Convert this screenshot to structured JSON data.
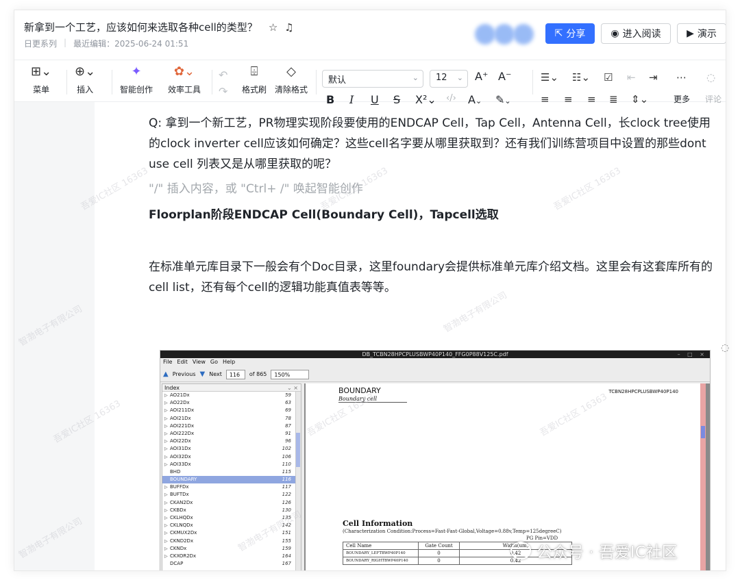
{
  "header": {
    "title": "新拿到一个工艺，应该如何来选取各种cell的类型？",
    "series": "日更系列",
    "last_edit": "最近编辑：2025-06-24 01:51",
    "share_label": "分享",
    "read_label": "进入阅读",
    "present_label": "演示"
  },
  "toolbar": {
    "menu_label": "菜单",
    "insert_label": "插入",
    "ai_label": "智能创作",
    "efficiency_label": "效率工具",
    "format_painter_label": "格式刷",
    "clear_format_label": "清除格式",
    "font_family": "默认",
    "font_size": "12",
    "more_label": "更多",
    "comment_label": "评论"
  },
  "content": {
    "question": "Q: 拿到一个新工艺，PR物理实现阶段要使用的ENDCAP Cell，Tap Cell，Antenna Cell，长clock tree使用的clock inverter cell应该如何确定？这些cell名字要从哪里获取到？还有我们训练营项目中设置的那些dont use cell 列表又是从哪里获取的呢？",
    "placeholder": "\"/\" 插入内容，或 \"Ctrl+ /\" 唤起智能创作",
    "heading": "Floorplan阶段ENDCAP Cell(Boundary Cell)，Tapcell选取",
    "paragraph": "在标准单元库目录下一般会有个Doc目录，这里foundary会提供标准单元库介绍文档。这里会有这套库所有的cell list，还有每个cell的逻辑功能真值表等等。"
  },
  "pdf_viewer": {
    "window_title": "DB_TCBN28HPCPLUSBWP40P140_FFG0P88V125C.pdf",
    "menu": [
      "File",
      "Edit",
      "View",
      "Go",
      "Help"
    ],
    "previous_label": "Previous",
    "next_label": "Next",
    "page_number": "116",
    "page_total": "of 865",
    "zoom": "150%",
    "index_header": "Index",
    "index_items": [
      {
        "name": "AO21Dx",
        "page": "59"
      },
      {
        "name": "AO22Dx",
        "page": "63"
      },
      {
        "name": "AOI211Dx",
        "page": "69"
      },
      {
        "name": "AOI21Dx",
        "page": "78"
      },
      {
        "name": "AOI221Dx",
        "page": "87"
      },
      {
        "name": "AOI222Dx",
        "page": "91"
      },
      {
        "name": "AOI22Dx",
        "page": "96"
      },
      {
        "name": "AOI31Dx",
        "page": "102"
      },
      {
        "name": "AOI32Dx",
        "page": "106"
      },
      {
        "name": "AOI33Dx",
        "page": "110"
      },
      {
        "name": "BHD",
        "page": "115"
      },
      {
        "name": "BOUNDARY",
        "page": "116"
      },
      {
        "name": "BUFFDx",
        "page": "117"
      },
      {
        "name": "BUFTDx",
        "page": "122"
      },
      {
        "name": "CKAN2Dx",
        "page": "126"
      },
      {
        "name": "CKBDx",
        "page": "130"
      },
      {
        "name": "CKLHQDx",
        "page": "135"
      },
      {
        "name": "CKLNQDx",
        "page": "142"
      },
      {
        "name": "CKMUX2Dx",
        "page": "151"
      },
      {
        "name": "CKND2Dx",
        "page": "155"
      },
      {
        "name": "CKNDx",
        "page": "159"
      },
      {
        "name": "CKXOR2Dx",
        "page": "164"
      },
      {
        "name": "DCAP",
        "page": "167"
      }
    ],
    "selected_index": 11,
    "page": {
      "section_title": "BOUNDARY",
      "section_subtitle": "Boundary cell",
      "library_name": "TCBN28HPCPLUSBWP40P140",
      "cell_info_title": "Cell Information",
      "condition": "(Characterization Condition:Process=Fast-Fast-Global,Voltage=0.88v,Temp=125degreeC)",
      "pg_pin": "PG Pin=VDD",
      "table_headers": [
        "Cell Name",
        "Gate Count",
        "Width(um)"
      ],
      "table_rows": [
        [
          "BOUNDARY_LEFTBWP40P140",
          "0",
          "0.42"
        ],
        [
          "BOUNDARY_RIGHTBWP40P140",
          "0",
          "0.42"
        ]
      ]
    }
  },
  "watermark": {
    "brand": "公众号 · 吾爱IC社区",
    "tile_a": "吾爱IC社区 16363",
    "tile_b": "智渤电子有限公司"
  }
}
